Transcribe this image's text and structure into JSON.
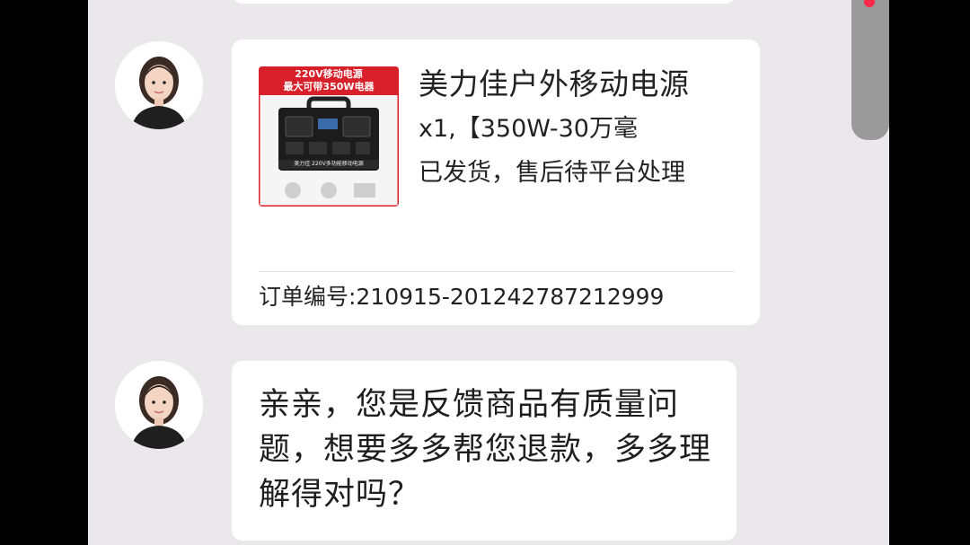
{
  "colors": {
    "chat_background": "#ebe8ec",
    "bubble": "#ffffff",
    "brand_red": "#d7202a",
    "badge_red": "#ff2a4a",
    "floating_panel": "#9a9a9a"
  },
  "order_card": {
    "product_image": {
      "banner_text": "220V移动电源\n最大可带350W电器",
      "device_label": "美力佳 220V多功能移动电源"
    },
    "product_title": "美力佳户外移动电源",
    "product_spec": "x1,【350W-30万毫",
    "status": "已发货，售后待平台处理",
    "order_number": "订单编号:210915-201242787212999"
  },
  "message": {
    "text": "亲亲，您是反馈商品有质量问题，想要多多帮您退款，多多理解得对吗？"
  },
  "icons": {
    "avatar": "agent-avatar-icon",
    "notification": "notification-dot-icon"
  }
}
